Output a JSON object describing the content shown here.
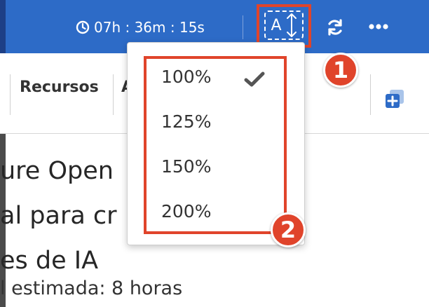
{
  "header": {
    "timer": "07h : 36m : 15s",
    "font_size_button_label": "A"
  },
  "tabs": {
    "recursos": "Recursos",
    "partial": "A"
  },
  "dropdown": {
    "options": [
      "100%",
      "125%",
      "150%",
      "200%"
    ],
    "selected": "100%"
  },
  "main": {
    "title_lines": [
      "ure Open",
      "al para cr",
      "es de IA"
    ],
    "duration": "l estimada: 8 horas"
  },
  "markers": [
    "1",
    "2"
  ],
  "colors": {
    "topbar": "#2d6bc7",
    "highlight": "#e0442b"
  }
}
